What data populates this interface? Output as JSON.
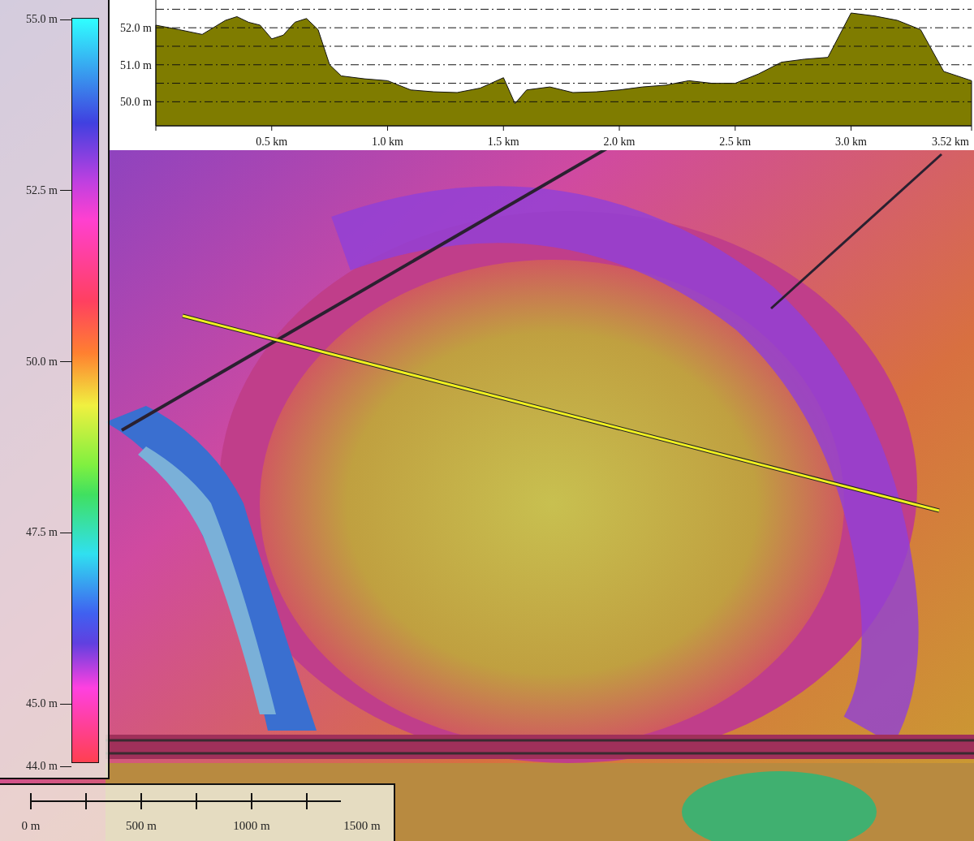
{
  "legend": {
    "ticks": [
      "55.0 m",
      "52.5 m",
      "50.0 m",
      "47.5 m",
      "45.0 m"
    ],
    "bottom_label": "44.0 m"
  },
  "profile": {
    "chart_data": {
      "type": "area",
      "xlim": [
        0,
        3.52
      ],
      "ylim": [
        49.35,
        52.75
      ],
      "x": [
        0,
        0.1,
        0.2,
        0.3,
        0.35,
        0.4,
        0.45,
        0.5,
        0.55,
        0.6,
        0.65,
        0.7,
        0.75,
        0.8,
        0.9,
        1.0,
        1.1,
        1.2,
        1.3,
        1.4,
        1.5,
        1.55,
        1.6,
        1.7,
        1.8,
        1.9,
        2.0,
        2.1,
        2.2,
        2.3,
        2.4,
        2.5,
        2.6,
        2.7,
        2.8,
        2.9,
        3.0,
        3.1,
        3.2,
        3.3,
        3.4,
        3.52
      ],
      "grid": true,
      "series": [
        {
          "color": "#7f7c00",
          "values": [
            52.07,
            51.95,
            51.82,
            52.2,
            52.3,
            52.15,
            52.07,
            51.7,
            51.8,
            52.15,
            52.25,
            51.95,
            51.0,
            50.7,
            50.62,
            50.57,
            50.32,
            50.27,
            50.25,
            50.37,
            50.65,
            49.95,
            50.32,
            50.4,
            50.25,
            50.27,
            50.32,
            50.4,
            50.45,
            50.57,
            50.5,
            50.5,
            50.75,
            51.07,
            51.15,
            51.2,
            52.4,
            52.32,
            52.2,
            51.95,
            50.82,
            50.57
          ]
        }
      ],
      "yticks": [
        {
          "value": 50,
          "label": "50.0 m"
        },
        {
          "value": 51,
          "label": "51.0 m"
        },
        {
          "value": 52,
          "label": "52.0 m"
        }
      ],
      "xticks": [
        {
          "value": 0.5,
          "label": "0.5 km"
        },
        {
          "value": 1.0,
          "label": "1.0 km"
        },
        {
          "value": 1.5,
          "label": "1.5 km"
        },
        {
          "value": 2.0,
          "label": "2.0 km"
        },
        {
          "value": 2.5,
          "label": "2.5 km"
        },
        {
          "value": 3.0,
          "label": "3.0 km"
        },
        {
          "value": 3.52,
          "label": "3.52 km"
        }
      ]
    }
  },
  "scale_bar": {
    "labels": [
      "0 m",
      "500 m",
      "1000 m",
      "1500 m"
    ]
  }
}
